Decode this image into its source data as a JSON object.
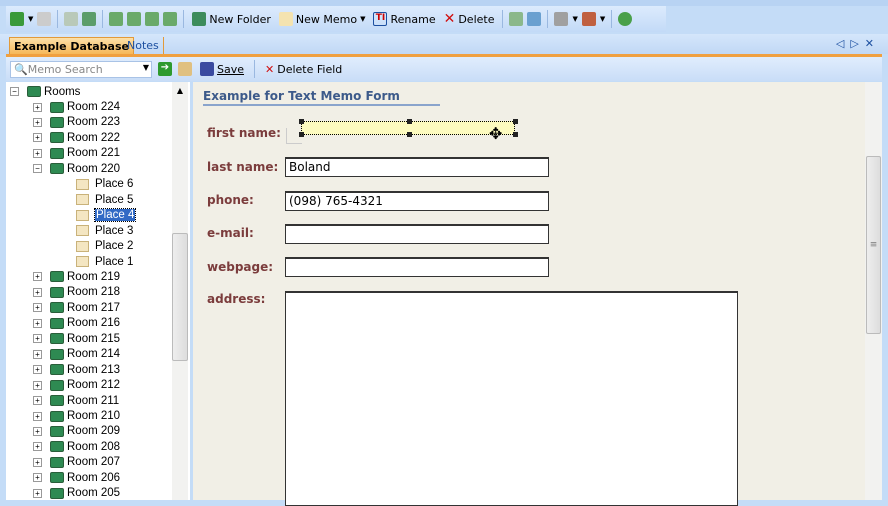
{
  "toolbar": {
    "new_folder": "New Folder",
    "new_memo": "New Memo",
    "rename": "Rename",
    "delete": "Delete"
  },
  "tabs": [
    {
      "label": "Example Database"
    },
    {
      "label": "Notes"
    }
  ],
  "search": {
    "placeholder": "Memo Search",
    "save": "Save",
    "delete_field": "Delete Field"
  },
  "tree": {
    "root": "Rooms",
    "rooms_top": [
      "Room 224",
      "Room 223",
      "Room 222",
      "Room 221"
    ],
    "expanded": "Room 220",
    "places": [
      "Place 6",
      "Place 5",
      "Place 4",
      "Place 3",
      "Place 2",
      "Place 1"
    ],
    "selected": "Place 4",
    "rooms_bottom": [
      "Room 219",
      "Room 218",
      "Room 217",
      "Room 216",
      "Room 215",
      "Room 214",
      "Room 213",
      "Room 212",
      "Room 211",
      "Room 210",
      "Room 209",
      "Room 208",
      "Room 207",
      "Room 206",
      "Room 205"
    ]
  },
  "form": {
    "title": "Example for Text Memo Form",
    "labels": {
      "first_name": "first name:",
      "last_name": "last name:",
      "phone": "phone:",
      "email": "e-mail:",
      "webpage": "webpage:",
      "address": "address:"
    },
    "values": {
      "first_name": "",
      "last_name": "Boland",
      "phone": "(098) 765-4321",
      "email": "",
      "webpage": "",
      "address": ""
    }
  }
}
